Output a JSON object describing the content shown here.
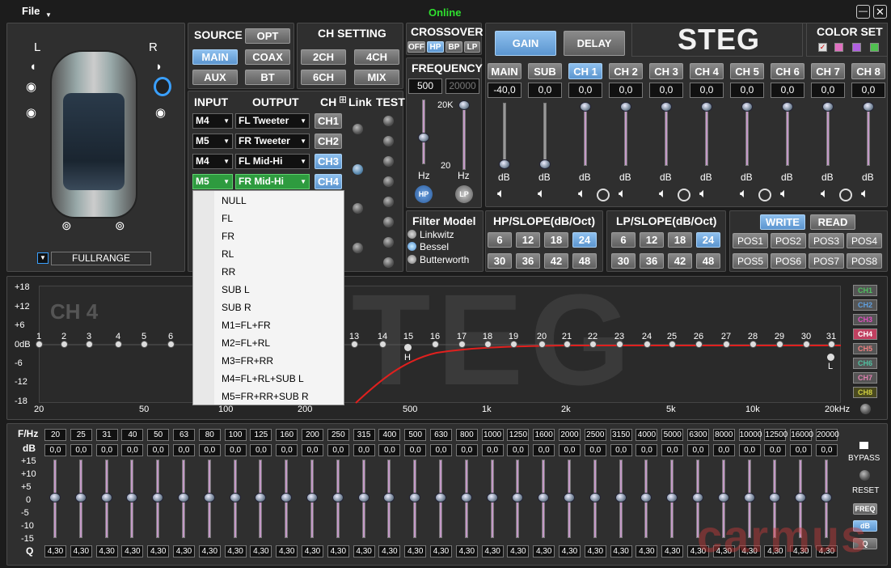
{
  "menu_file": "File",
  "status": "Online",
  "brand": "STEG",
  "side": {
    "left": "L",
    "right": "R",
    "fullrange": "FULLRANGE"
  },
  "source": {
    "title": "SOURCE",
    "buttons": [
      "OPT",
      "MAIN",
      "COAX",
      "AUX",
      "BT"
    ],
    "active": "MAIN"
  },
  "ch_setting": {
    "title": "CH SETTING",
    "buttons": [
      "2CH",
      "4CH",
      "6CH",
      "MIX"
    ]
  },
  "crossover": {
    "title": "CROSSOVER",
    "buttons": [
      "OFF",
      "HP",
      "BP",
      "LP"
    ],
    "active": "HP"
  },
  "frequency": {
    "title": "FREQUENCY",
    "hp_value": "500",
    "lp_value": "20000",
    "top": "20K",
    "bottom": "20",
    "hz": "Hz",
    "hp_btn": "HP",
    "lp_btn": "LP"
  },
  "io": {
    "input": "INPUT",
    "output": "OUTPUT",
    "ch": "CH",
    "link": "Link",
    "test": "TEST",
    "rows": [
      {
        "in": "M4",
        "out": "FL Tweeter",
        "ch": "CH1"
      },
      {
        "in": "M5",
        "out": "FR Tweeter",
        "ch": "CH2"
      },
      {
        "in": "M4",
        "out": "FL Mid-Hi",
        "ch": "CH3"
      },
      {
        "in": "M5",
        "out": "FR Mid-Hi",
        "ch": "CH4"
      }
    ]
  },
  "dropdown_options": [
    "NULL",
    "FL",
    "FR",
    "RL",
    "RR",
    "SUB L",
    "SUB R",
    "M1=FL+FR",
    "M2=FL+RL",
    "M3=FR+RR",
    "M4=FL+RL+SUB L",
    "M5=FR+RR+SUB R"
  ],
  "gain_tab": "GAIN",
  "delay_tab": "DELAY",
  "color_set": {
    "title": "COLOR SET",
    "colors": [
      "#e0e0e0",
      "#e070c0",
      "#b060e0",
      "#50c050"
    ]
  },
  "channels": {
    "labels": [
      "MAIN",
      "SUB",
      "CH 1",
      "CH 2",
      "CH 3",
      "CH 4",
      "CH 5",
      "CH 6",
      "CH 7",
      "CH 8"
    ],
    "values": [
      "-40,0",
      "0,0",
      "0,0",
      "0,0",
      "0,0",
      "0,0",
      "0,0",
      "0,0",
      "0,0",
      "0,0"
    ],
    "active": "CH 1",
    "unit": "dB"
  },
  "filter_model": {
    "title": "Filter Model",
    "options": [
      "Linkwitz",
      "Bessel",
      "Butterworth"
    ],
    "selected": "Bessel"
  },
  "hp_slope": {
    "title": "HP/SLOPE(dB/Oct)",
    "values": [
      "6",
      "12",
      "18",
      "24",
      "30",
      "36",
      "42",
      "48"
    ],
    "active": "24"
  },
  "lp_slope": {
    "title": "LP/SLOPE(dB/Oct)",
    "values": [
      "6",
      "12",
      "18",
      "24",
      "30",
      "36",
      "42",
      "48"
    ],
    "active": "24"
  },
  "memory": {
    "write": "WRITE",
    "read": "READ",
    "positions": [
      "POS1",
      "POS2",
      "POS3",
      "POS4",
      "POS5",
      "POS6",
      "POS7",
      "POS8"
    ]
  },
  "graph": {
    "channel": "CH 4",
    "y_ticks": [
      "+18",
      "+12",
      "+6",
      "0dB",
      "-6",
      "-12",
      "-18"
    ],
    "x_ticks": [
      "20",
      "50",
      "100",
      "200",
      "500",
      "1k",
      "2k",
      "5k",
      "10k",
      "20kHz"
    ],
    "bands": [
      "1",
      "2",
      "3",
      "4",
      "5",
      "6",
      "13",
      "14",
      "15",
      "16",
      "17",
      "18",
      "19",
      "20",
      "21",
      "22",
      "23",
      "24",
      "25",
      "26",
      "27",
      "28",
      "29",
      "30",
      "31"
    ],
    "h_marker": "H",
    "l_marker": "L"
  },
  "ch_tabs": [
    {
      "label": "CH1",
      "color": "#4fc060"
    },
    {
      "label": "CH2",
      "color": "#60a0e0"
    },
    {
      "label": "CH3",
      "color": "#e050c0"
    },
    {
      "label": "CH4",
      "color": "#ff4060"
    },
    {
      "label": "CH5",
      "color": "#f08080"
    },
    {
      "label": "CH6",
      "color": "#50c0a0"
    },
    {
      "label": "CH7",
      "color": "#e080b0"
    },
    {
      "label": "CH8",
      "color": "#d0d040"
    }
  ],
  "eq": {
    "freq_label": "F/Hz",
    "db_label": "dB",
    "q_label": "Q",
    "scale": [
      "+15",
      "+10",
      "+5",
      "0",
      "-5",
      "-10",
      "-15"
    ],
    "freqs": [
      "20",
      "25",
      "31",
      "40",
      "50",
      "63",
      "80",
      "100",
      "125",
      "160",
      "200",
      "250",
      "315",
      "400",
      "500",
      "630",
      "800",
      "1000",
      "1250",
      "1600",
      "2000",
      "2500",
      "3150",
      "4000",
      "5000",
      "6300",
      "8000",
      "10000",
      "12500",
      "16000",
      "20000"
    ],
    "db_value": "0,0",
    "q_value": "4,30"
  },
  "right_ctrl": {
    "bypass": "BYPASS",
    "reset": "RESET",
    "freq": "FREQ",
    "db": "dB",
    "q": "Q"
  },
  "watermark": "carmus"
}
